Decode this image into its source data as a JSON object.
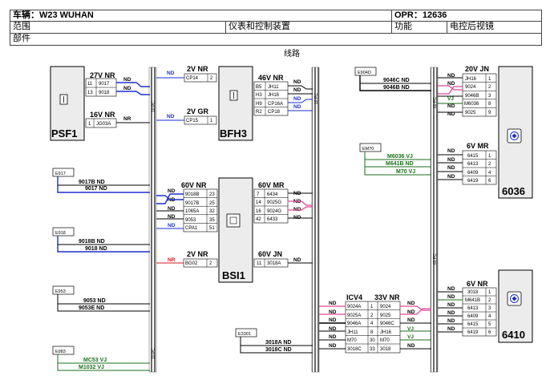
{
  "header": {
    "vehicle_label": "车辆：W23 WUHAN",
    "opr_label": "OPR：12636",
    "scope_label": "范围",
    "system_label": "仪表和控制装置",
    "function_label": "功能",
    "function_value": "电控后视镜",
    "part_label": "部件",
    "section_title": "线路"
  },
  "colors": {
    "blue": "#1b2fd1",
    "pink": "#e0479a",
    "green": "#1a6e1a",
    "red": "#d21a1a",
    "black": "#000000",
    "bar_hatch": "#6b6b6b"
  },
  "bars": {
    "b1": "10 PC",
    "b2": "10 PC",
    "b3": "60 PC",
    "b4": "60 PC",
    "b5": "10 PC"
  },
  "components": {
    "psf1": "PSF1",
    "bfh3": "BFH3",
    "bsi1": "BSI1",
    "c6036": "6036",
    "c6410": "6410",
    "e917": "E917",
    "e918": "E918",
    "e953": "E953",
    "e983": "E983",
    "e904d": "E904D",
    "em70": "EM70",
    "e3301": "E3301"
  },
  "connectors": {
    "psf1_a": {
      "title": "27V NR",
      "rows": [
        [
          "11",
          "9017"
        ],
        [
          "13",
          "9018"
        ]
      ],
      "wires": [
        "ND",
        "ND"
      ]
    },
    "psf1_b": {
      "title": "16V NR",
      "rows": [
        [
          "1",
          "JG03A"
        ]
      ],
      "wires": [
        "NR"
      ]
    },
    "bfh3_a": {
      "title": "2V NR",
      "rows": [
        [
          "CP14",
          "2"
        ]
      ],
      "wires": [
        "ND"
      ]
    },
    "bfh3_b": {
      "title": "2V GR",
      "rows": [
        [
          "CP15",
          "1"
        ]
      ],
      "wires": [
        "ND"
      ]
    },
    "bfh3_c": {
      "title": "46V NR",
      "rows": [
        [
          "B5",
          "JH11"
        ],
        [
          "H3",
          "JH16"
        ],
        [
          "H9",
          "CP16A"
        ],
        [
          "R2",
          "CP18"
        ]
      ],
      "wires": [
        "ND",
        "ND",
        "ND",
        "ND"
      ]
    },
    "bsi_l": {
      "title": "60V NR",
      "rows": [
        [
          "9018B",
          "23"
        ],
        [
          "9017B",
          "25"
        ],
        [
          "1065A",
          "32"
        ],
        [
          "9053",
          "35"
        ],
        [
          "CPA1",
          "51"
        ]
      ],
      "wires": [
        "ND",
        "ND",
        "ND",
        "ND",
        "ND"
      ]
    },
    "bsi_r": {
      "title": "60V MR",
      "rows": [
        [
          "7",
          "6434"
        ],
        [
          "14",
          "9025G"
        ],
        [
          "16",
          "9024G"
        ],
        [
          "42",
          "6433"
        ]
      ],
      "wires": [
        "ND",
        "ND",
        "ND",
        "ND"
      ]
    },
    "bsi_l2": {
      "title": "2V NR",
      "rows": [
        [
          "BG02",
          "2"
        ]
      ],
      "wires": [
        "NR"
      ]
    },
    "bsi_r2": {
      "title": "60V JN",
      "rows": [
        [
          "11",
          "3018A"
        ]
      ],
      "wires": [
        "ND"
      ]
    },
    "icv4_l": {
      "title": "ICV4",
      "rows": [
        [
          "9024A",
          "1"
        ],
        [
          "9025A",
          "2"
        ],
        [
          "9046A",
          "4"
        ],
        [
          "JH11",
          "8"
        ],
        [
          "M70",
          "30"
        ],
        [
          "3018C",
          "33"
        ]
      ],
      "wires": [
        "ND",
        "ND",
        "ND",
        "ND",
        "ND",
        "ND"
      ]
    },
    "icv4_r": {
      "title": "33V NR",
      "rows": [
        [
          "9024"
        ],
        [
          "9025"
        ],
        [
          "9046C"
        ],
        [
          "JH16"
        ],
        [
          "M70"
        ],
        [
          "3018"
        ]
      ],
      "wires": [
        "ND",
        "ND",
        "ND",
        "VJ",
        "VJ",
        "ND"
      ]
    },
    "c6036_a": {
      "title": "20V JN",
      "rows": [
        [
          "JH16",
          "1"
        ],
        [
          "9024",
          "2"
        ],
        [
          "9046B",
          "3"
        ],
        [
          "M6036",
          "8"
        ],
        [
          "9025",
          "9"
        ]
      ],
      "wires": [
        "ND",
        "ND",
        "VJ",
        "ND",
        "ND"
      ]
    },
    "c6036_b": {
      "title": "6V MR",
      "rows": [
        [
          "6415",
          "1"
        ],
        [
          "6413",
          "2"
        ],
        [
          "6409",
          "4"
        ],
        [
          "6419",
          "6"
        ]
      ],
      "wires": [
        "ND",
        "ND",
        "ND",
        "ND"
      ]
    },
    "c6410_a": {
      "title": "6V NR",
      "rows": [
        [
          "3018",
          "1"
        ],
        [
          "M641B",
          "2"
        ],
        [
          "6413",
          "3"
        ],
        [
          "6409",
          "4"
        ],
        [
          "6415",
          "5"
        ],
        [
          "6419",
          "6"
        ]
      ],
      "wires": [
        "ND",
        "ND",
        "ND",
        "ND",
        "ND",
        "ND"
      ]
    }
  },
  "left_wires": {
    "w9017b": "9017B ND",
    "w9017": "9017 ND",
    "w9018b": "9018B ND",
    "w9018": "9018 ND",
    "w9053": "9053 ND",
    "w9053e": "9053E ND",
    "wmc53": "MC53 VJ",
    "wm1032": "M1032 VJ"
  },
  "right_wires": {
    "w9046c": "9046C ND",
    "w9046b": "9046B ND",
    "wm6036": "M6036 VJ",
    "wm641b": "M641B ND",
    "wm70": "M70 VJ",
    "w3018a": "3018A ND",
    "w3018c": "3018C ND"
  }
}
